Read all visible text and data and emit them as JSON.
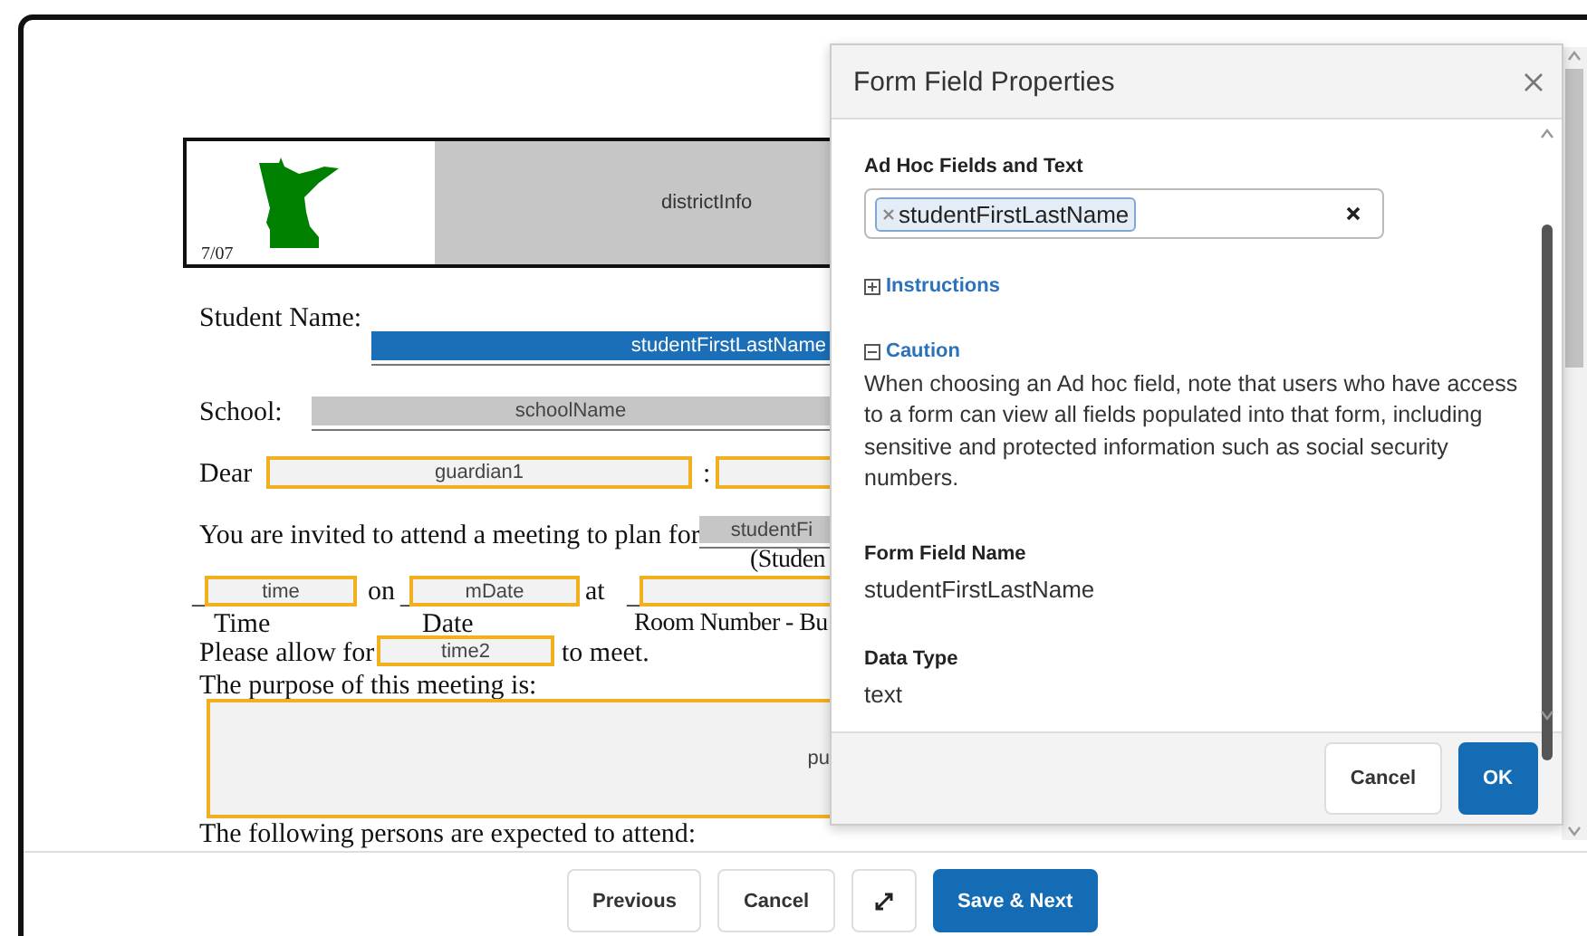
{
  "document": {
    "header": {
      "date": "7/07",
      "district_field": "districtInfo"
    },
    "items": [
      {
        "kind": "text",
        "text": "Student Name:"
      },
      {
        "kind": "system_field",
        "selected": true,
        "text": "studentFirstLastName"
      },
      {
        "kind": "text",
        "text": "School:"
      },
      {
        "kind": "system_field",
        "selected": false,
        "text": "schoolName"
      },
      {
        "kind": "text",
        "text": "Dear"
      },
      {
        "kind": "user_field",
        "selected": false,
        "text": "guardian1"
      },
      {
        "kind": "text",
        "text": ":"
      },
      {
        "kind": "user_field",
        "selected": false
      },
      {
        "kind": "text",
        "text": "You are invited to attend a meeting to plan for"
      },
      {
        "kind": "system_field",
        "selected": false,
        "text": "studentFi"
      },
      {
        "kind": "text",
        "text": "(Studen"
      },
      {
        "kind": "text",
        "text": "_"
      },
      {
        "kind": "user_field",
        "selected": false,
        "text": "time"
      },
      {
        "kind": "text",
        "text": "on"
      },
      {
        "kind": "text",
        "text": "_"
      },
      {
        "kind": "user_field",
        "selected": false,
        "text": "mDate"
      },
      {
        "kind": "text",
        "text": "at"
      },
      {
        "kind": "text",
        "text": "_"
      },
      {
        "kind": "user_field",
        "selected": false
      },
      {
        "kind": "text",
        "text": "Time"
      },
      {
        "kind": "text",
        "text": "Date"
      },
      {
        "kind": "text",
        "text": "Room Number - Bu"
      },
      {
        "kind": "text",
        "text": "Please allow for"
      },
      {
        "kind": "user_field",
        "selected": false,
        "text": "time2"
      },
      {
        "kind": "text",
        "text": "to meet."
      },
      {
        "kind": "text",
        "text": "The purpose of this meeting is:"
      },
      {
        "kind": "user_field",
        "selected": false,
        "text": "pu"
      },
      {
        "kind": "text",
        "text": "The following persons are expected to attend:"
      }
    ]
  },
  "footer_buttons": [
    {
      "label": "Previous",
      "kind": "plain"
    },
    {
      "label": "Cancel",
      "kind": "plain"
    },
    {
      "kind": "expand"
    },
    {
      "label": "Save & Next",
      "kind": "primary"
    }
  ],
  "dialog": {
    "title": "Form Field Properties",
    "adhoc_label": "Ad Hoc Fields and Text",
    "adhoc_chip": "studentFirstLastName",
    "sections": [
      {
        "title": "Instructions",
        "expanded": false
      },
      {
        "title": "Caution",
        "expanded": true,
        "body": "When choosing an Ad hoc field, note that users who have access to a form can view all fields populated into that form, including sensitive and protected information such as social security numbers."
      }
    ],
    "field_name_label": "Form Field Name",
    "field_name": "studentFirstLastName",
    "data_type_label": "Data Type",
    "data_type": "text",
    "buttons": [
      {
        "label": "Cancel",
        "kind": "plain"
      },
      {
        "label": "OK",
        "kind": "primary"
      }
    ]
  }
}
